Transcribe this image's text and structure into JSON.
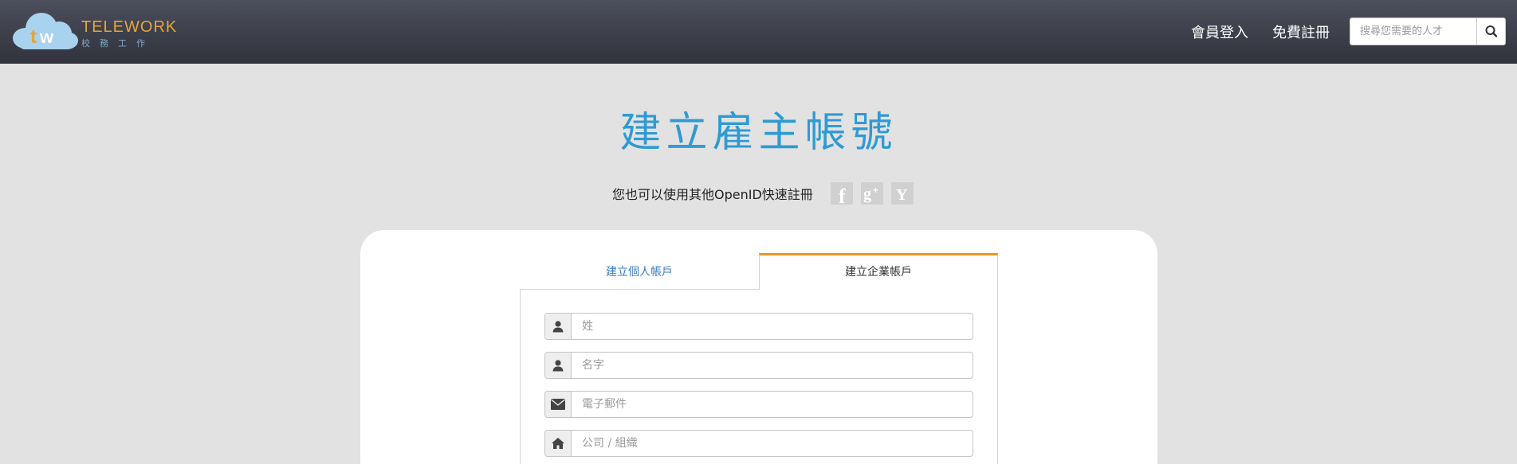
{
  "header": {
    "brand_en": "TELEWORK",
    "brand_zh": "校務工作",
    "login": "會員登入",
    "register": "免費註冊",
    "search_placeholder": "搜尋您需要的人才"
  },
  "page": {
    "title": "建立雇主帳號",
    "openid_text": "您也可以使用其他OpenID快速註冊",
    "social": [
      {
        "icon": "facebook-icon",
        "glyph": "f"
      },
      {
        "icon": "google-plus-icon",
        "glyph": "g+"
      },
      {
        "icon": "yahoo-icon",
        "glyph": "Y"
      }
    ]
  },
  "tabs": {
    "personal": "建立個人帳戶",
    "company": "建立企業帳戶",
    "active": "company"
  },
  "form": {
    "last_name_placeholder": "姓",
    "first_name_placeholder": "名字",
    "email_placeholder": "電子郵件",
    "company_placeholder": "公司 / 組織"
  },
  "colors": {
    "title": "#2f9ad3",
    "active_tab": "#e8981f",
    "header": "#3b3e49",
    "background": "#e2e2e2"
  }
}
